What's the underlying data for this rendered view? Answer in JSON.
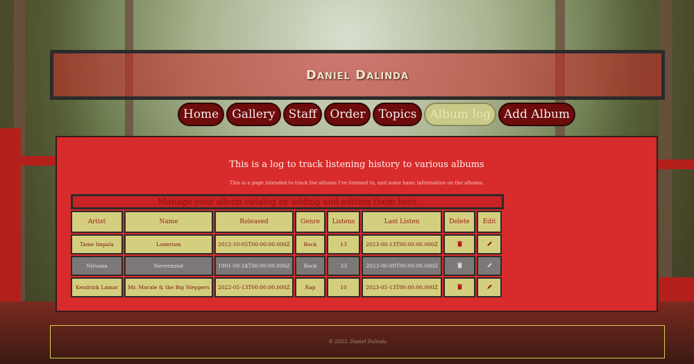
{
  "site": {
    "title": "Daniel Dalinda"
  },
  "nav": {
    "items": [
      "Home",
      "Gallery",
      "Staff",
      "Order",
      "Topics",
      "Album log",
      "Add Album"
    ],
    "active_index": 5
  },
  "main": {
    "heading": "This is a log to track listening history to various albums",
    "subheading": "This is a page intended to track the albums I've listened to, and some basic information on the albums.",
    "table_caption": "Manage your album catalog by adding and editing them here",
    "columns": [
      "Artist",
      "Name",
      "Released",
      "Genre",
      "Listens",
      "Last Listen",
      "Delete",
      "Edit"
    ],
    "rows": [
      {
        "artist": "Tame Impala",
        "name": "Lonerism",
        "released": "2012-10-05T00:00:00.000Z",
        "genre": "Rock",
        "listens": "13",
        "last_listen": "2023-06-13T00:00:00.000Z"
      },
      {
        "artist": "Nirvana",
        "name": "Nevermind",
        "released": "1991-09-24T00:00:00.000Z",
        "genre": "Rock",
        "listens": "33",
        "last_listen": "2023-06-09T00:00:00.000Z"
      },
      {
        "artist": "Kendrick Lamar",
        "name": "Mr. Morale & the Big Steppers",
        "released": "2022-05-13T00:00:00.000Z",
        "genre": "Rap",
        "listens": "10",
        "last_listen": "2023-05-13T00:00:00.000Z"
      }
    ],
    "highlighted_row": 1,
    "icons": {
      "delete": "trash-icon",
      "edit": "pencil-icon"
    }
  },
  "footer": {
    "copyright": "© 2023, Daniel Dalinda"
  },
  "colors": {
    "panel": "#d82b2b",
    "cell": "#d4cf7e",
    "nav": "#6e0b0b",
    "active_nav": "#c9c988",
    "highlight_row": "#7c7878"
  }
}
